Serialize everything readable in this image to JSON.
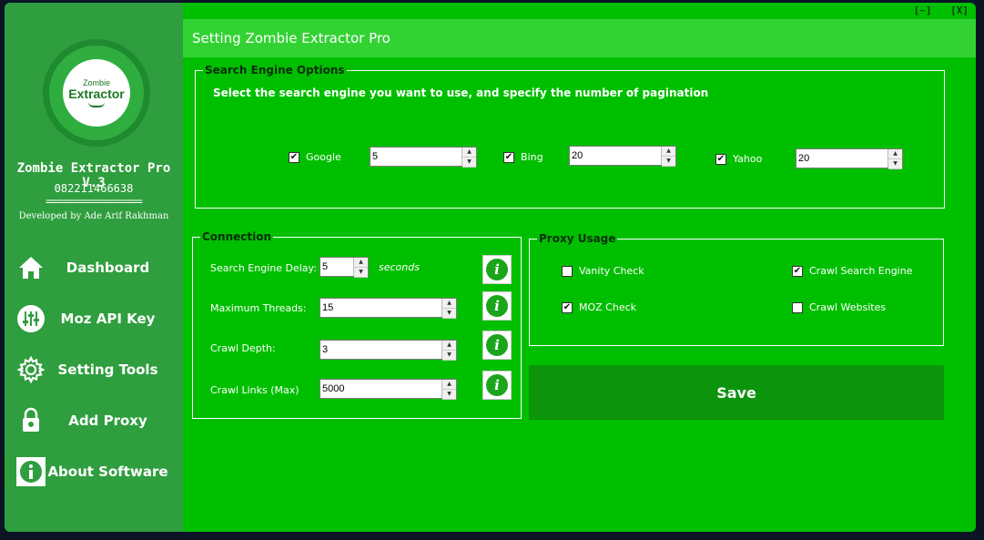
{
  "window": {
    "title": "Setting Zombie Extractor Pro",
    "minimize_label": "[~]",
    "close_label": "[X]"
  },
  "sidebar": {
    "logo": {
      "small_text": "Zombie",
      "big_text": "Extractor"
    },
    "app_name": "Zombie Extractor Pro V.3",
    "phone": "082211466638",
    "separator": "=================",
    "developer": "Developed by Ade Arif Rakhman",
    "items": [
      {
        "label": "Dashboard",
        "icon": "home-icon"
      },
      {
        "label": "Moz API Key",
        "icon": "sliders-icon"
      },
      {
        "label": "Setting Tools",
        "icon": "gear-icon"
      },
      {
        "label": "Add Proxy",
        "icon": "lock-icon"
      },
      {
        "label": "About Software",
        "icon": "info-icon"
      }
    ]
  },
  "search_engine": {
    "legend": "Search Engine Options",
    "description": "Select the search engine you want to use, and specify the number of pagination",
    "engines": [
      {
        "label": "Google",
        "checked": true,
        "value": "5"
      },
      {
        "label": "Bing",
        "checked": true,
        "value": "20"
      },
      {
        "label": "Yahoo",
        "checked": true,
        "value": "20"
      }
    ]
  },
  "connection": {
    "legend": "Connection",
    "fields": [
      {
        "label": "Search Engine Delay:",
        "value": "5",
        "unit": "seconds"
      },
      {
        "label": "Maximum Threads:",
        "value": "15"
      },
      {
        "label": "Crawl Depth:",
        "value": "3"
      },
      {
        "label": "Crawl Links (Max)",
        "value": "5000"
      }
    ]
  },
  "proxy": {
    "legend": "Proxy Usage",
    "options": [
      {
        "label": "Vanity Check",
        "checked": false
      },
      {
        "label": "Crawl Search Engine",
        "checked": true
      },
      {
        "label": "MOZ Check",
        "checked": true
      },
      {
        "label": "Crawl Websites",
        "checked": false
      }
    ]
  },
  "save_label": "Save",
  "colors": {
    "main_bg": "#00bf00",
    "sidebar_bg": "#2f9e3e",
    "header_bg": "#33d233",
    "save_bg": "#0d940d"
  }
}
